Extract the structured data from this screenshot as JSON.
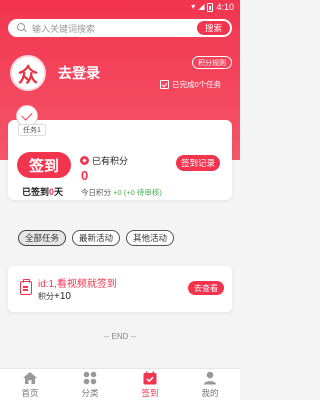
{
  "status_bar": {
    "time": "4:10"
  },
  "search": {
    "placeholder": "输入关键词搜索",
    "button_label": "搜索"
  },
  "profile": {
    "avatar_char": "众",
    "login_label": "去登录",
    "rules_label": "积分规则",
    "completed_text": "已完成0个任务"
  },
  "sign_card": {
    "task_tag": "任务1",
    "sign_button_label": "签到",
    "signed_prefix": "已签到",
    "signed_days": "0",
    "signed_suffix": "天",
    "points_title": "已有积分",
    "points_value": "0",
    "today_prefix": "今日积分",
    "today_points": "+0",
    "pending_text": "(+0 待审核)",
    "record_button_label": "签到记录"
  },
  "tabs": [
    {
      "label": "全部任务",
      "active": true
    },
    {
      "label": "最新活动",
      "active": false
    },
    {
      "label": "其他活动",
      "active": false
    }
  ],
  "task": {
    "title": "id:1,看视频就签到",
    "points_prefix": "积分",
    "points_value": "+10",
    "button_label": "去查看"
  },
  "end_text": "-- END --",
  "nav": [
    {
      "label": "首页",
      "icon": "home-icon",
      "active": false
    },
    {
      "label": "分类",
      "icon": "category-icon",
      "active": false
    },
    {
      "label": "签到",
      "icon": "calendar-check-icon",
      "active": true
    },
    {
      "label": "我的",
      "icon": "user-icon",
      "active": false
    }
  ],
  "colors": {
    "accent": "#f2344f",
    "background": "#f4f4f4"
  }
}
